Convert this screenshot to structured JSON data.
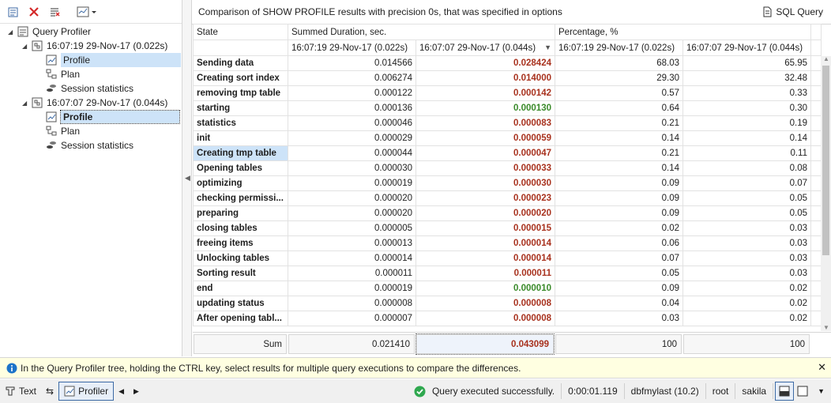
{
  "tree": {
    "root": "Query Profiler",
    "runs": [
      {
        "label": "16:07:19 29-Nov-17 (0.022s)",
        "children": [
          "Profile",
          "Plan",
          "Session statistics"
        ]
      },
      {
        "label": "16:07:07 29-Nov-17 (0.044s)",
        "children": [
          "Profile",
          "Plan",
          "Session statistics"
        ]
      }
    ]
  },
  "header": {
    "title": "Comparison of SHOW PROFILE results with precision 0s, that was specified in options",
    "sql_query": "SQL Query"
  },
  "grid": {
    "col_state": "State",
    "col_duration": "Summed Duration, sec.",
    "col_percentage": "Percentage, %",
    "sub1": "16:07:19 29-Nov-17 (0.022s)",
    "sub2": "16:07:07 29-Nov-17 (0.044s)",
    "sub3": "16:07:19 29-Nov-17 (0.022s)",
    "sub4": "16:07:07 29-Nov-17 (0.044s)",
    "rows": [
      {
        "state": "Sending data",
        "d1": "0.014566",
        "d2": "0.028424",
        "d2c": "red",
        "p1": "68.03",
        "p2": "65.95"
      },
      {
        "state": "Creating sort index",
        "d1": "0.006274",
        "d2": "0.014000",
        "d2c": "red",
        "p1": "29.30",
        "p2": "32.48"
      },
      {
        "state": "removing tmp table",
        "d1": "0.000122",
        "d2": "0.000142",
        "d2c": "red",
        "p1": "0.57",
        "p2": "0.33"
      },
      {
        "state": "starting",
        "d1": "0.000136",
        "d2": "0.000130",
        "d2c": "green",
        "p1": "0.64",
        "p2": "0.30"
      },
      {
        "state": "statistics",
        "d1": "0.000046",
        "d2": "0.000083",
        "d2c": "red",
        "p1": "0.21",
        "p2": "0.19"
      },
      {
        "state": "init",
        "d1": "0.000029",
        "d2": "0.000059",
        "d2c": "red",
        "p1": "0.14",
        "p2": "0.14"
      },
      {
        "state": "Creating tmp table",
        "d1": "0.000044",
        "d2": "0.000047",
        "d2c": "red",
        "p1": "0.21",
        "p2": "0.11"
      },
      {
        "state": "Opening tables",
        "d1": "0.000030",
        "d2": "0.000033",
        "d2c": "red",
        "p1": "0.14",
        "p2": "0.08"
      },
      {
        "state": "optimizing",
        "d1": "0.000019",
        "d2": "0.000030",
        "d2c": "red",
        "p1": "0.09",
        "p2": "0.07"
      },
      {
        "state": "checking permissi...",
        "d1": "0.000020",
        "d2": "0.000023",
        "d2c": "red",
        "p1": "0.09",
        "p2": "0.05"
      },
      {
        "state": "preparing",
        "d1": "0.000020",
        "d2": "0.000020",
        "d2c": "red",
        "p1": "0.09",
        "p2": "0.05"
      },
      {
        "state": "closing tables",
        "d1": "0.000005",
        "d2": "0.000015",
        "d2c": "red",
        "p1": "0.02",
        "p2": "0.03"
      },
      {
        "state": "freeing items",
        "d1": "0.000013",
        "d2": "0.000014",
        "d2c": "red",
        "p1": "0.06",
        "p2": "0.03"
      },
      {
        "state": "Unlocking tables",
        "d1": "0.000014",
        "d2": "0.000014",
        "d2c": "red",
        "p1": "0.07",
        "p2": "0.03"
      },
      {
        "state": "Sorting result",
        "d1": "0.000011",
        "d2": "0.000011",
        "d2c": "red",
        "p1": "0.05",
        "p2": "0.03"
      },
      {
        "state": "end",
        "d1": "0.000019",
        "d2": "0.000010",
        "d2c": "green",
        "p1": "0.09",
        "p2": "0.02"
      },
      {
        "state": "updating status",
        "d1": "0.000008",
        "d2": "0.000008",
        "d2c": "red",
        "p1": "0.04",
        "p2": "0.02"
      },
      {
        "state": "After opening tabl...",
        "d1": "0.000007",
        "d2": "0.000008",
        "d2c": "red",
        "p1": "0.03",
        "p2": "0.02"
      }
    ],
    "sum": {
      "label": "Sum",
      "d1": "0.021410",
      "d2": "0.043099",
      "p1": "100",
      "p2": "100"
    }
  },
  "info": "In the Query Profiler tree, holding the CTRL key, select results for multiple query executions to compare the differences.",
  "statusbar": {
    "text": "Text",
    "profiler": "Profiler",
    "status": "Query executed successfully.",
    "time": "0:00:01.119",
    "connection": "dbfmylast (10.2)",
    "user": "root",
    "db": "sakila"
  },
  "colors": {
    "red": "#a8321e",
    "green": "#3a8a2a",
    "info_bg": "#ffffe1",
    "selection": "#cde3f8"
  }
}
